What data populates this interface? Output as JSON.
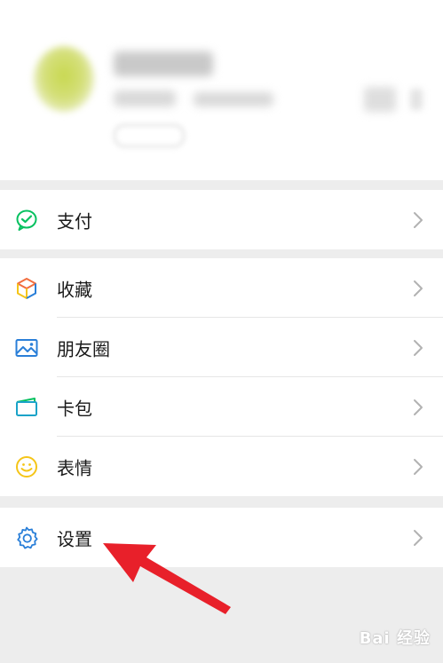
{
  "menu": {
    "pay": {
      "label": "支付",
      "icon": "wechat-pay-icon"
    },
    "favorites": {
      "label": "收藏",
      "icon": "favorites-cube-icon"
    },
    "moments": {
      "label": "朋友圈",
      "icon": "moments-picture-icon"
    },
    "cards": {
      "label": "卡包",
      "icon": "card-wallet-icon"
    },
    "stickers": {
      "label": "表情",
      "icon": "smiley-icon"
    },
    "settings": {
      "label": "设置",
      "icon": "gear-icon"
    }
  },
  "annotation": {
    "arrow_color": "#e8202a",
    "watermark": "Bai 经验"
  },
  "colors": {
    "pay_green": "#07c160",
    "settings_blue": "#2a7fd8",
    "stickers_yellow": "#f5c518",
    "moments_blue": "#2a7fd8",
    "cards_teal": "#1aa3c8"
  }
}
